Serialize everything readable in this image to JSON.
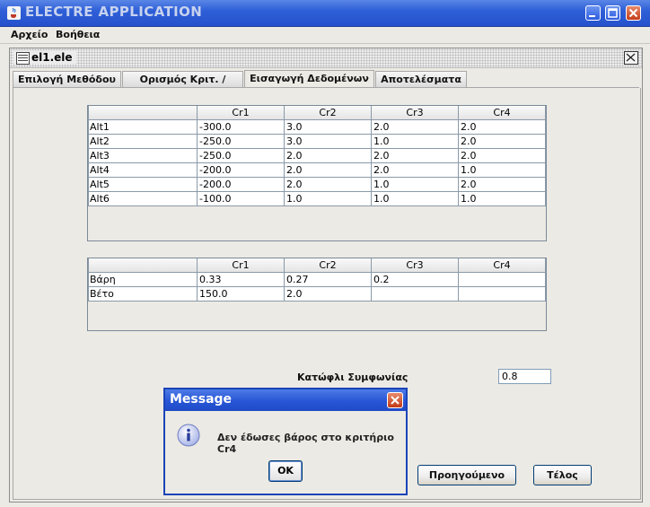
{
  "window": {
    "title": "ELECTRE APPLICATION"
  },
  "menu": [
    "Αρχείο",
    "Βοήθεια"
  ],
  "inner_frame": {
    "title": "el1.ele"
  },
  "tabs": [
    "Επιλογή Μεθόδου",
    "Ορισμός Κριτ. / Εναλ.",
    "Εισαγωγή Δεδομένων",
    "Αποτελέσματα"
  ],
  "active_tab": "Εισαγωγή Δεδομένων",
  "alternatives_table": {
    "columns": [
      "",
      "Cr1",
      "Cr2",
      "Cr3",
      "Cr4"
    ],
    "rows": [
      [
        "Alt1",
        "-300.0",
        "3.0",
        "2.0",
        "2.0"
      ],
      [
        "Alt2",
        "-250.0",
        "3.0",
        "1.0",
        "2.0"
      ],
      [
        "Alt3",
        "-250.0",
        "2.0",
        "2.0",
        "2.0"
      ],
      [
        "Alt4",
        "-200.0",
        "2.0",
        "2.0",
        "1.0"
      ],
      [
        "Alt5",
        "-200.0",
        "2.0",
        "1.0",
        "2.0"
      ],
      [
        "Alt6",
        "-100.0",
        "1.0",
        "1.0",
        "1.0"
      ]
    ]
  },
  "weights_table": {
    "columns": [
      "",
      "Cr1",
      "Cr2",
      "Cr3",
      "Cr4"
    ],
    "rows": [
      [
        "Βάρη",
        "0.33",
        "0.27",
        "0.2",
        ""
      ],
      [
        "Βέτο",
        "150.0",
        "2.0",
        "",
        ""
      ]
    ]
  },
  "threshold": {
    "label": "Κατώφλι Συμφωνίας",
    "value": "0.8"
  },
  "buttons": {
    "previous": "Προηγούμενο",
    "finish": "Τέλος"
  },
  "dialog": {
    "title": "Message",
    "message": "Δεν έδωσες βάρος στο κριτήριο Cr4",
    "ok": "OK",
    "icon": "info-icon"
  }
}
